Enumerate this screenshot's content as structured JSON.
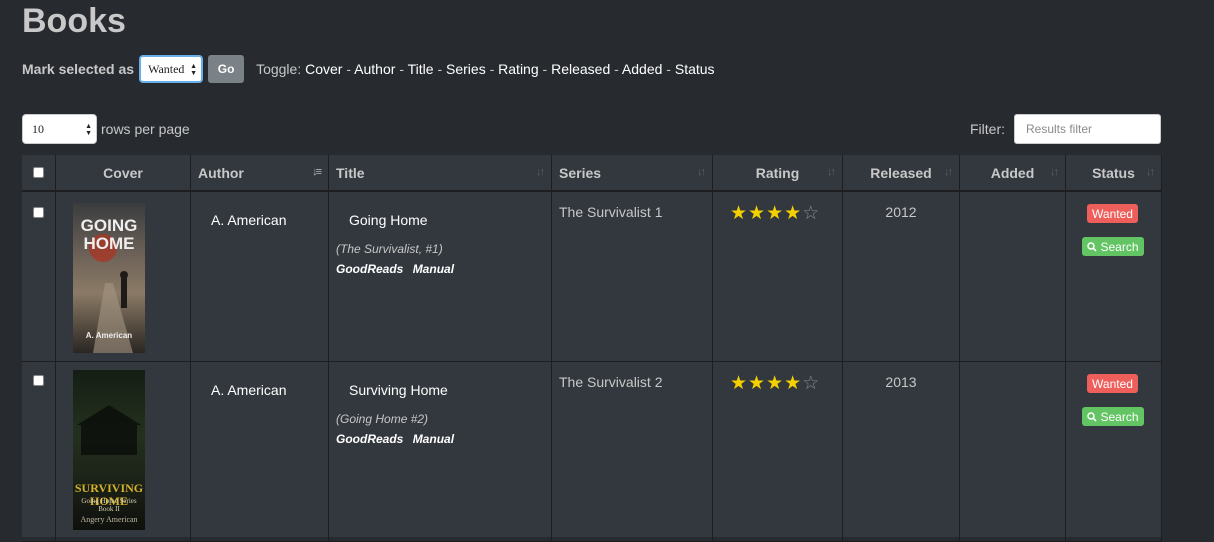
{
  "page": {
    "title": "Books"
  },
  "mark": {
    "label": "Mark selected as",
    "selected": "Wanted",
    "go_label": "Go"
  },
  "toggle": {
    "label": "Toggle:",
    "items": [
      "Cover",
      "Author",
      "Title",
      "Series",
      "Rating",
      "Released",
      "Added",
      "Status"
    ],
    "separator": "-"
  },
  "rows": {
    "value": "10",
    "label": "rows per page"
  },
  "filter": {
    "label": "Filter:",
    "placeholder": "Results filter"
  },
  "table": {
    "columns": [
      "Cover",
      "Author",
      "Title",
      "Series",
      "Rating",
      "Released",
      "Added",
      "Status"
    ],
    "rows": [
      {
        "cover": {
          "title_line1": "GOING",
          "title_line2": "HOME",
          "author": "A. American"
        },
        "author": "A. American",
        "title": "Going Home",
        "subtitle": "(The Survivalist, #1)",
        "links": [
          "GoodReads",
          "Manual"
        ],
        "series": "The Survivalist 1",
        "rating": 4,
        "released": "2012",
        "added": "",
        "status": "Wanted",
        "search_label": "Search"
      },
      {
        "cover": {
          "title_line1": "SURVIVING HOME",
          "title_line2": "Going Home Series Book II",
          "author": "Angery American"
        },
        "author": "A. American",
        "title": "Surviving Home",
        "subtitle": "(Going Home #2)",
        "links": [
          "GoodReads",
          "Manual"
        ],
        "series": "The Survivalist 2",
        "rating": 4,
        "released": "2013",
        "added": "",
        "status": "Wanted",
        "search_label": "Search"
      }
    ]
  },
  "colors": {
    "background": "#272b30",
    "table": "#32383e",
    "wanted": "#ee5f5b",
    "search": "#62c462",
    "star": "#f5d000"
  }
}
